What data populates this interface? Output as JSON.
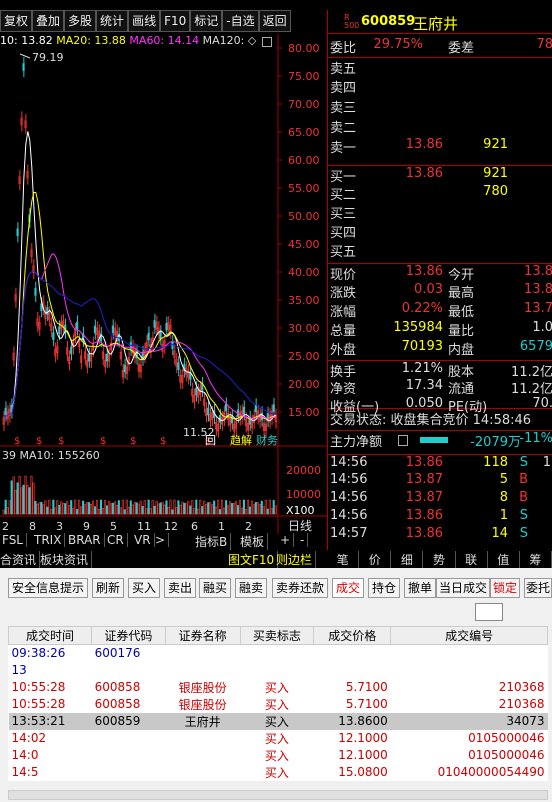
{
  "toolbar": {
    "items": [
      "复权",
      "叠加",
      "多股",
      "统计",
      "画线",
      "F10",
      "标记",
      "-自选",
      "返回"
    ]
  },
  "ma": {
    "ma10": "10: 13.82",
    "ma20": "MA20: 13.88",
    "ma60": "MA60: 14.14",
    "ma120": "MA120: ◇"
  },
  "chart": {
    "price_axis": [
      "80.00",
      "75.00",
      "70.00",
      "65.00",
      "60.00",
      "55.00",
      "50.00",
      "45.00",
      "40.00",
      "35.00",
      "30.00",
      "25.00",
      "20.00",
      "15.00"
    ],
    "peak": "79.19",
    "low": "11.52",
    "vol_axis": [
      "20000",
      "10000",
      "X100"
    ],
    "vol_label": "39  MA10: 155260",
    "x_labels": [
      "2",
      "8",
      "3",
      "9",
      "5",
      "11",
      "12",
      "6",
      "1",
      "2"
    ],
    "k_tag": "日线",
    "annot": [
      "回",
      "趋解",
      "财务"
    ]
  },
  "stock": {
    "sub": "R\n500",
    "code": "600859",
    "name": "王府井"
  },
  "orderbook": {
    "weibi_label": "委比",
    "weibi": "29.75%",
    "weicha_label": "委差",
    "weicha": "78",
    "asks": [
      "卖五",
      "卖四",
      "卖三",
      "卖二",
      "卖一"
    ],
    "ask1_price": "13.86",
    "ask1_vol": "921",
    "bids": [
      "买一",
      "买二",
      "买三",
      "买四",
      "买五"
    ],
    "bid1_price": "13.86",
    "bid1_vol": "921",
    "bid2_vol": "780"
  },
  "quote": {
    "rows": [
      [
        "现价",
        "13.86",
        "今开",
        "13.8"
      ],
      [
        "涨跌",
        "0.03",
        "最高",
        "13.8"
      ],
      [
        "涨幅",
        "0.22%",
        "最低",
        "13.7"
      ],
      [
        "总量",
        "135984",
        "量比",
        "1.0"
      ],
      [
        "外盘",
        "70193",
        "内盘",
        "6579"
      ]
    ],
    "rows2": [
      [
        "换手",
        "1.21%",
        "股本",
        "11.2亿"
      ],
      [
        "净资",
        "17.34",
        "流通",
        "11.2亿"
      ],
      [
        "收益(一)",
        "0.050",
        "PE(动)",
        "70."
      ]
    ],
    "status": "交易状态: 收盘集合竞价 14:58:46",
    "main_label": "主力净额",
    "main_val": "-2079万",
    "main_pct": "-11%"
  },
  "ticks": [
    [
      "14:56",
      "13.86",
      "118",
      "S",
      "1"
    ],
    [
      "14:56",
      "13.87",
      "5",
      "B",
      ""
    ],
    [
      "14:56",
      "13.87",
      "8",
      "B",
      ""
    ],
    [
      "14:56",
      "13.86",
      "1",
      "S",
      ""
    ],
    [
      "14:57",
      "13.86",
      "14",
      "S",
      ""
    ]
  ],
  "bottom_nav": [
    "FSL",
    "TRIX",
    "BRAR",
    "CR",
    "VR",
    ">",
    "指标B",
    "模板",
    "+",
    "-"
  ],
  "bottom_nav2": [
    "合资讯",
    "板块资讯",
    "图文F10",
    "则边栏"
  ],
  "right_tabs": [
    "笔",
    "价",
    "细",
    "势",
    "联",
    "值",
    "筹"
  ],
  "trade": {
    "buttons": [
      "安全信息提示",
      "刷新",
      "买入",
      "卖出",
      "融买",
      "融卖",
      "卖券还款",
      "成交",
      "持仓",
      "撤单",
      "当日成交",
      "锁定",
      "委托"
    ],
    "columns": [
      "成交时间",
      "证券代码",
      "证券名称",
      "买卖标志",
      "成交价格",
      "成交编号"
    ],
    "rows": [
      [
        "09:38:26",
        "600176",
        "",
        "",
        "",
        ""
      ],
      [
        "13",
        "",
        "",
        "",
        "",
        ""
      ],
      [
        "10:55:28",
        "600858",
        "银座股份",
        "买入",
        "5.7100",
        "210368"
      ],
      [
        "10:55:28",
        "600858",
        "银座股份",
        "买入",
        "5.7100",
        "210368"
      ],
      [
        "13:53:21",
        "600859",
        "王府井",
        "买入",
        "13.8600",
        "34073"
      ],
      [
        "14:02",
        "",
        "",
        "买入",
        "12.1000",
        "0105000046"
      ],
      [
        "14:0",
        "",
        "",
        "买入",
        "12.1000",
        "0105000046"
      ],
      [
        "14:5",
        "",
        "",
        "买入",
        "15.0800",
        "01040000054490"
      ]
    ]
  },
  "colors": {
    "up": "#e33333",
    "down": "#22c0c0",
    "ma10": "#ffffff",
    "ma20": "#ffff00",
    "ma60": "#ff33ff",
    "ma120": "#2020d0",
    "accent": "#ffff00"
  }
}
